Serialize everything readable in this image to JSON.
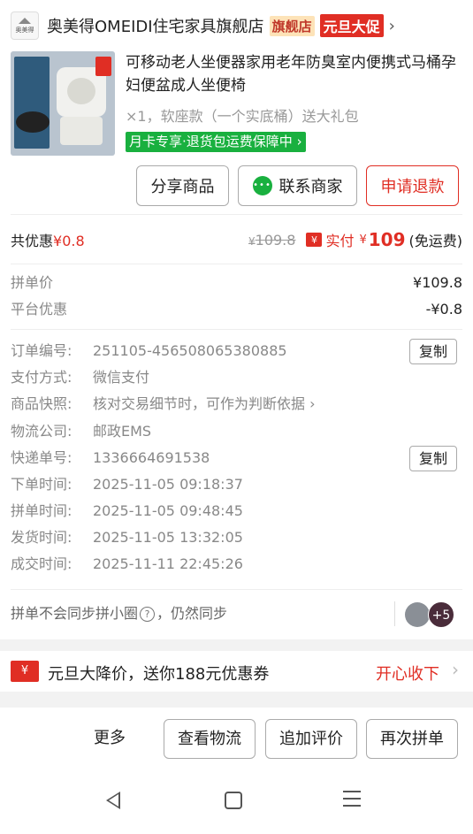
{
  "shop": {
    "logo_text": "奥美得",
    "name": "奥美得OMEIDI住宅家具旗舰店",
    "flag_badge": "旗舰店",
    "promo_badge": "元旦大促"
  },
  "product": {
    "title": "可移动老人坐便器家用老年防臭室内便携式马桶孕妇便盆成人坐便椅",
    "spec": "×1，软座款（一个实底桶）送大礼包",
    "guarantee": "月卡专享·退货包运费保障中",
    "guarantee_chev": "›"
  },
  "actions": {
    "share": "分享商品",
    "contact": "联系商家",
    "refund": "申请退款"
  },
  "price": {
    "discount_label": "共优惠",
    "discount_value": "¥0.8",
    "original_symbol": "¥",
    "original": "109.8",
    "pay_icon_text": "¥",
    "paid_label": "实付",
    "paid_symbol": "¥",
    "paid_amount": "109",
    "shipping": "(免运费)"
  },
  "breakdown": {
    "group_price_label": "拼单价",
    "group_price": "¥109.8",
    "platform_discount_label": "平台优惠",
    "platform_discount": "-¥0.8"
  },
  "order_info": {
    "order_no_label": "订单编号:",
    "order_no": "251105-456508065380885",
    "copy_label": "复制",
    "payment_label": "支付方式:",
    "payment": "微信支付",
    "snapshot_label": "商品快照:",
    "snapshot": "核对交易细节时，可作为判断依据",
    "logistics_label": "物流公司:",
    "logistics": "邮政EMS",
    "tracking_label": "快递单号:",
    "tracking": "1336664691538",
    "order_time_label": "下单时间:",
    "order_time": "2025-11-05 09:18:37",
    "group_time_label": "拼单时间:",
    "group_time": "2025-11-05 09:48:45",
    "ship_time_label": "发货时间:",
    "ship_time": "2025-11-05 13:32:05",
    "deal_time_label": "成交时间:",
    "deal_time": "2025-11-11 22:45:26"
  },
  "group_sync": {
    "text_a": "拼单不会同步拼小圈",
    "help_icon": "?",
    "text_b": "，仍然同步",
    "avatar_count": "+5"
  },
  "promo": {
    "icon_text": "¥",
    "text": "元旦大降价，送你188元优惠券",
    "cta": "开心收下"
  },
  "bottom_bar": {
    "more": "更多",
    "logistics": "查看物流",
    "review": "追加评价",
    "rebuy": "再次拼单"
  },
  "colors": {
    "accent_red": "#e02e24",
    "green": "#19b03f"
  },
  "icons": [
    "shop-logo-icon",
    "chat-icon",
    "chevron-right-icon",
    "pay-icon",
    "coupon-icon",
    "help-icon",
    "back-icon",
    "home-icon",
    "menu-icon"
  ]
}
